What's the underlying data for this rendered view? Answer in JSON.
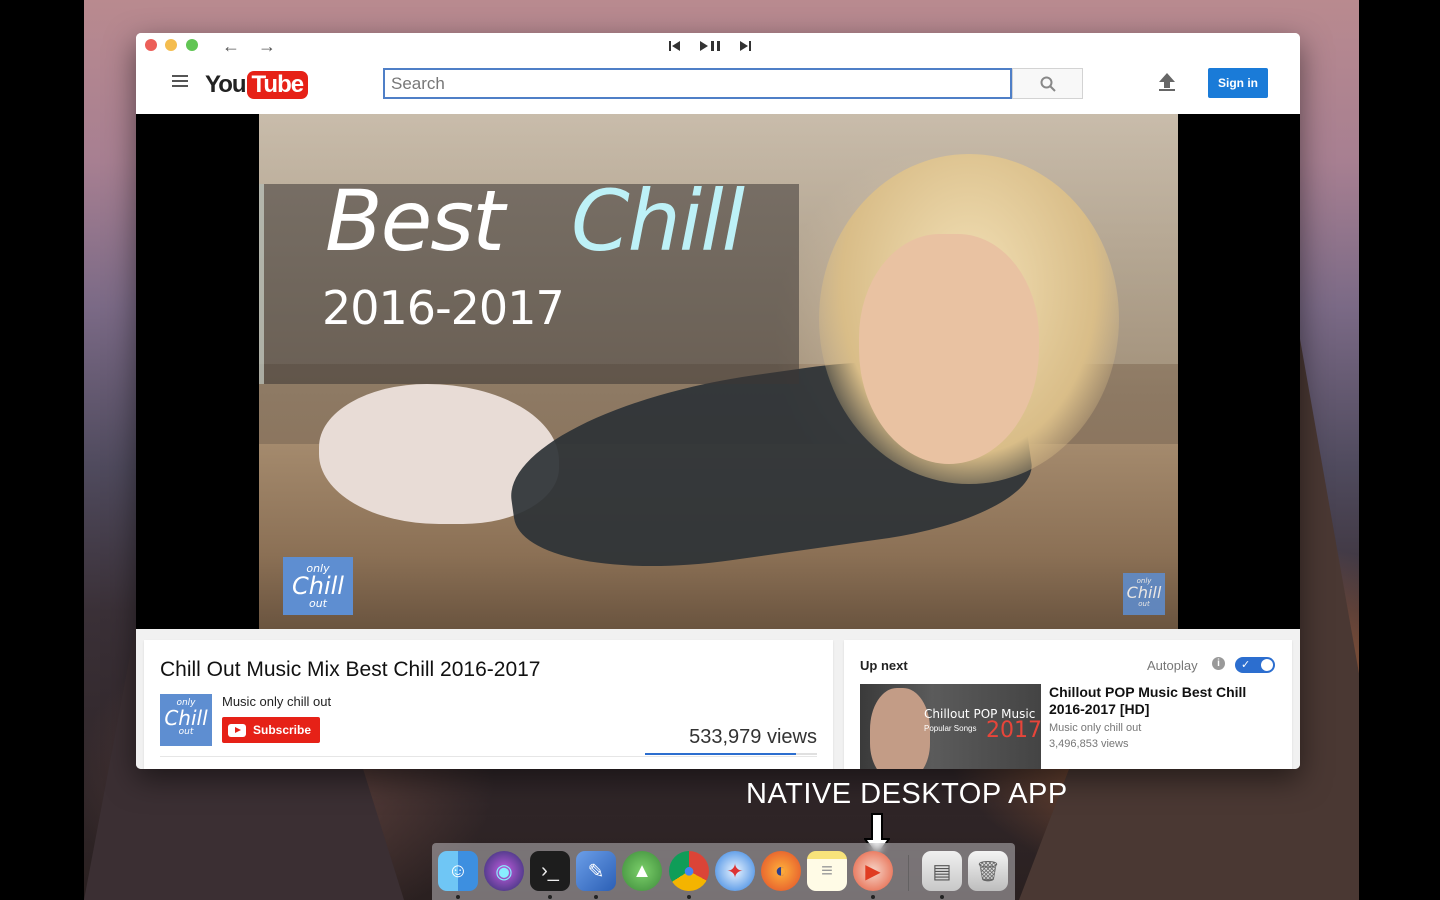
{
  "window": {
    "search_placeholder": "Search",
    "sign_in_label": "Sign in"
  },
  "media_controls": {
    "prev": "⏮",
    "play_pause": "⏯",
    "next": "⏭"
  },
  "player": {
    "overlay_title_1": "Best",
    "overlay_title_2": "Chill",
    "overlay_year": "2016-2017",
    "badge_small": "only",
    "badge_main": "Chill",
    "badge_bottom": "out"
  },
  "video": {
    "title": "Chill Out Music Mix Best Chill 2016-2017",
    "channel_name": "Music only chill out",
    "subscribe_label": "Subscribe",
    "views": "533,979 views",
    "like_ratio": 0.88
  },
  "up_next": {
    "label": "Up next",
    "autoplay_label": "Autoplay",
    "autoplay_on": true,
    "item": {
      "title": "Chillout POP Music Best Chill 2016-2017 [HD]",
      "channel": "Music only chill out",
      "views": "3,496,853 views",
      "thumb_text_1": "Chillout POP Music",
      "thumb_text_2": "Popular Songs",
      "thumb_text_3": "2017"
    }
  },
  "annotation": "NATIVE DESKTOP APP",
  "dock": {
    "icons": [
      "finder-icon",
      "siri-icon",
      "terminal-icon",
      "preview-icon",
      "rocket-icon",
      "chrome-icon",
      "safari-icon",
      "firefox-icon",
      "notes-icon",
      "youtube-app-icon",
      "archive-icon",
      "trash-icon"
    ]
  },
  "colors": {
    "youtube_red": "#e62117",
    "accent_blue": "#1a7bd8",
    "channel_blue": "#5e8ed1",
    "chill_cyan": "#bdf1f7"
  }
}
